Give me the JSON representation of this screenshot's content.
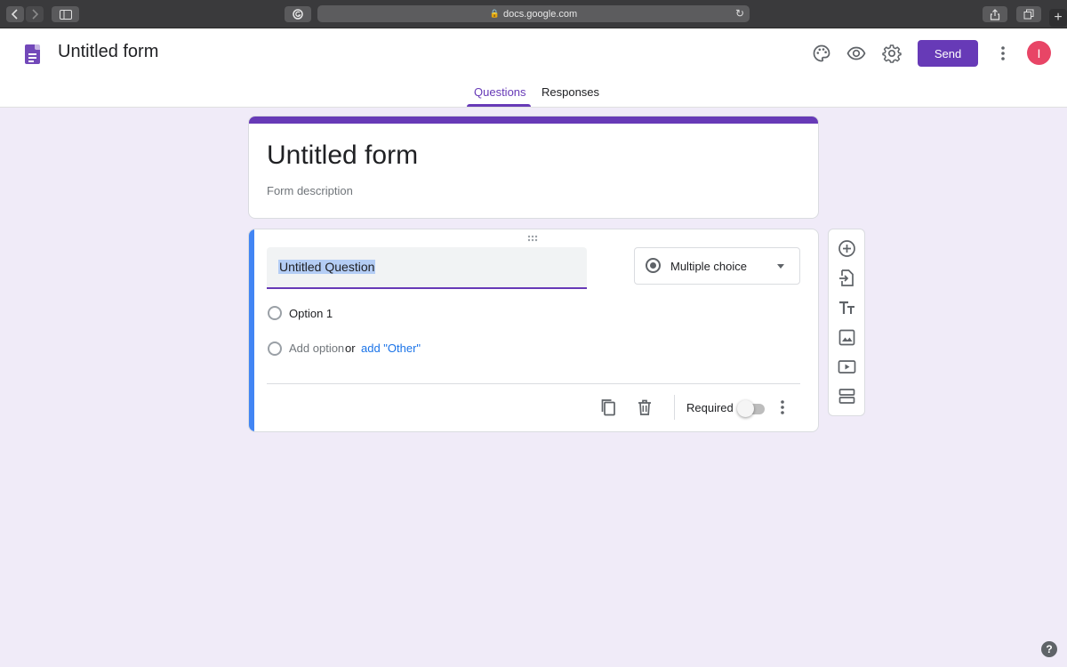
{
  "browser": {
    "url": "docs.google.com",
    "lock_icon": "lock-icon",
    "new_tab_glyph": "+"
  },
  "header": {
    "doc_title": "Untitled form",
    "send_label": "Send",
    "avatar_initial": "I",
    "icons": [
      "palette-icon",
      "eye-icon",
      "gear-icon",
      "more-vert-icon"
    ],
    "tabs": [
      {
        "label": "Questions",
        "active": true
      },
      {
        "label": "Responses",
        "active": false
      }
    ]
  },
  "form": {
    "title": "Untitled form",
    "description": "Form description"
  },
  "question": {
    "title": "Untitled Question",
    "type": "Multiple choice",
    "options": [
      "Option 1"
    ],
    "add_option": "Add option",
    "or_text": "or",
    "add_other": "add \"Other\"",
    "required_label": "Required",
    "required": false
  },
  "side_toolbar": {
    "items": [
      "add-question-icon",
      "import-questions-icon",
      "add-title-icon",
      "add-image-icon",
      "add-video-icon",
      "add-section-icon"
    ]
  },
  "help": "?",
  "colors": {
    "accent": "#673ab7",
    "background": "#f0ebf8",
    "active_question": "#4285f4",
    "link": "#1a73e8"
  }
}
